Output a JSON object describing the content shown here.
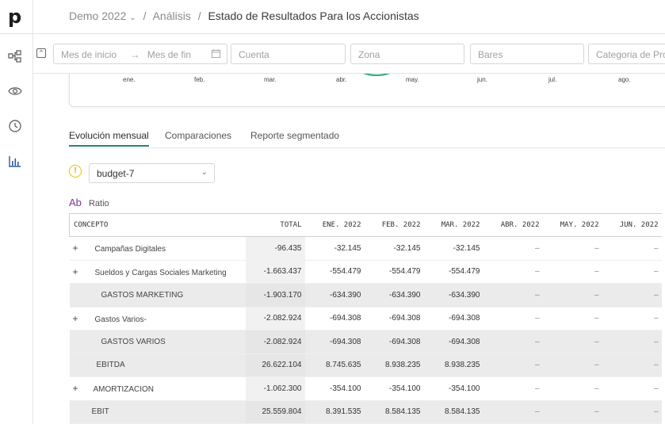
{
  "app": {
    "logo_letter": "p"
  },
  "sidebar": {
    "items": [
      "structure-icon",
      "eye-icon",
      "clock-icon",
      "bar-chart-icon"
    ]
  },
  "breadcrumb": {
    "items": [
      "Demo 2022",
      "Análisis",
      "Estado de Resultados Para los Accionistas"
    ]
  },
  "filters": {
    "start_placeholder": "Mes de inicio",
    "end_placeholder": "Mes de fin",
    "cuenta": "Cuenta",
    "zona": "Zona",
    "bares": "Bares",
    "categoria": "Categoria de Pro"
  },
  "chart": {
    "months": [
      "ene.",
      "feb.",
      "mar.",
      "abr.",
      "may.",
      "jun.",
      "jul.",
      "ago."
    ],
    "colors": {
      "line1": "#2aa67d",
      "line2": "#9cc3d6"
    }
  },
  "tabs": [
    "Evolución mensual",
    "Comparaciones",
    "Reporte segmentado"
  ],
  "scenario": {
    "value": "budget-7"
  },
  "ratio": {
    "icon": "Ab",
    "label": "Ratio"
  },
  "table": {
    "headers": [
      "CONCEPTO",
      "TOTAL",
      "ENE. 2022",
      "FEB. 2022",
      "MAR. 2022",
      "ABR. 2022",
      "MAY. 2022",
      "JUN. 2022"
    ],
    "rows": [
      {
        "name": "Campañas Digitales",
        "expand": true,
        "indent": 1,
        "sum": false,
        "values": [
          "-96.435",
          "-32.145",
          "-32.145",
          "-32.145",
          "–",
          "–",
          "–"
        ]
      },
      {
        "name": "Sueldos y Cargas Sociales Marketing",
        "expand": true,
        "indent": 1,
        "sum": false,
        "values": [
          "-1.663.437",
          "-554.479",
          "-554.479",
          "-554.479",
          "–",
          "–",
          "–"
        ]
      },
      {
        "name": "GASTOS MARKETING",
        "expand": false,
        "indent": 0,
        "sum": true,
        "values": [
          "-1.903.170",
          "-634.390",
          "-634.390",
          "-634.390",
          "–",
          "–",
          "–"
        ]
      },
      {
        "name": "Gastos Varios-",
        "expand": true,
        "indent": 1,
        "sum": false,
        "values": [
          "-2.082.924",
          "-694.308",
          "-694.308",
          "-694.308",
          "–",
          "–",
          "–"
        ]
      },
      {
        "name": "GASTOS VARIOS",
        "expand": false,
        "indent": 0,
        "sum": true,
        "values": [
          "-2.082.924",
          "-694.308",
          "-694.308",
          "-694.308",
          "–",
          "–",
          "–"
        ]
      },
      {
        "name": "EBITDA",
        "expand": false,
        "indent": -1,
        "sum": true,
        "values": [
          "26.622.104",
          "8.745.635",
          "8.938.235",
          "8.938.235",
          "–",
          "–",
          "–"
        ]
      },
      {
        "name": "AMORTIZACION",
        "expand": true,
        "indent": 0,
        "sum": false,
        "values": [
          "-1.062.300",
          "-354.100",
          "-354.100",
          "-354.100",
          "–",
          "–",
          "–"
        ]
      },
      {
        "name": "EBIT",
        "expand": false,
        "indent": -2,
        "sum": true,
        "values": [
          "25.559.804",
          "8.391.535",
          "8.584.135",
          "8.584.135",
          "–",
          "–",
          "–"
        ]
      }
    ]
  }
}
